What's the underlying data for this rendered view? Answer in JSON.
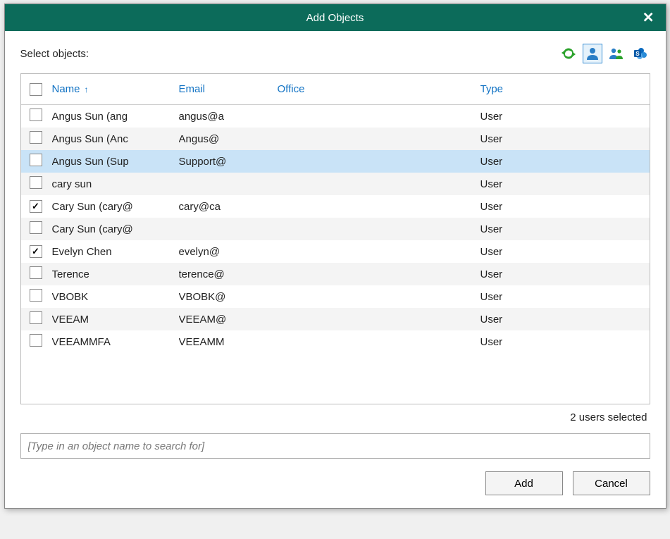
{
  "title": "Add Objects",
  "select_label": "Select objects:",
  "columns": {
    "name": "Name",
    "email": "Email",
    "office": "Office",
    "type": "Type"
  },
  "rows": [
    {
      "checked": false,
      "highlight": false,
      "name": "Angus Sun (ang",
      "email": "angus@a",
      "office": "",
      "type": "User"
    },
    {
      "checked": false,
      "highlight": false,
      "name": "Angus Sun (Anc",
      "email": "Angus@",
      "office": "",
      "type": "User"
    },
    {
      "checked": false,
      "highlight": true,
      "name": "Angus Sun (Sup",
      "email": "Support@",
      "office": "",
      "type": "User"
    },
    {
      "checked": false,
      "highlight": false,
      "name": "cary sun",
      "email": "",
      "office": "",
      "type": "User"
    },
    {
      "checked": true,
      "highlight": false,
      "name": "Cary Sun (cary@",
      "email": "cary@ca",
      "office": "",
      "type": "User"
    },
    {
      "checked": false,
      "highlight": false,
      "name": "Cary Sun (cary@",
      "email": "",
      "office": "",
      "type": "User"
    },
    {
      "checked": true,
      "highlight": false,
      "name": "Evelyn Chen",
      "email": "evelyn@",
      "office": "",
      "type": "User"
    },
    {
      "checked": false,
      "highlight": false,
      "name": "Terence",
      "email": "terence@",
      "office": "",
      "type": "User"
    },
    {
      "checked": false,
      "highlight": false,
      "name": "VBOBK",
      "email": "VBOBK@",
      "office": "",
      "type": "User"
    },
    {
      "checked": false,
      "highlight": false,
      "name": "VEEAM",
      "email": "VEEAM@",
      "office": "",
      "type": "User"
    },
    {
      "checked": false,
      "highlight": false,
      "name": "VEEAMMFA",
      "email": "VEEAMM",
      "office": "",
      "type": "User"
    }
  ],
  "status": "2 users selected",
  "search_placeholder": "[Type in an object name to search for]",
  "buttons": {
    "add": "Add",
    "cancel": "Cancel"
  }
}
